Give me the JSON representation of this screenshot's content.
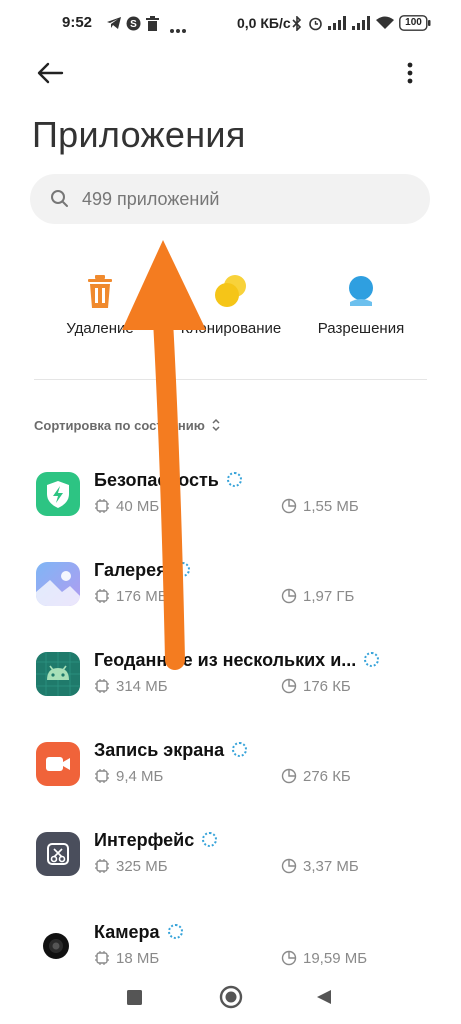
{
  "status_bar": {
    "time": "9:52",
    "network_speed": "0,0 КБ/с",
    "battery": "100"
  },
  "header": {
    "title": "Приложения"
  },
  "search": {
    "placeholder": "499 приложений"
  },
  "shortcuts": [
    {
      "label": "Удаление",
      "icon": "trash-icon",
      "color": "#f08a2e"
    },
    {
      "label": "Клонирование",
      "icon": "clone-icon",
      "color": "#f5c518"
    },
    {
      "label": "Разрешения",
      "icon": "permissions-icon",
      "color": "#2f9fe0"
    }
  ],
  "sort": {
    "label": "Сортировка по состоянию"
  },
  "apps": [
    {
      "name": "Безопасность",
      "memory": "40 МБ",
      "data": "1,55 МБ",
      "icon": "security-icon",
      "color": "#2dc483"
    },
    {
      "name": "Галерея",
      "memory": "176 МБ",
      "data": "1,97 ГБ",
      "icon": "gallery-icon",
      "color": "#8f9bf0"
    },
    {
      "name": "Геоданные из нескольких и...",
      "memory": "314 МБ",
      "data": "176 КБ",
      "icon": "android-icon",
      "color": "#1f7a6b"
    },
    {
      "name": "Запись экрана",
      "memory": "9,4 МБ",
      "data": "276 КБ",
      "icon": "screen-record-icon",
      "color": "#f0633a"
    },
    {
      "name": "Интерфейс",
      "memory": "325 МБ",
      "data": "3,37 МБ",
      "icon": "interface-icon",
      "color": "#4a4e5c"
    },
    {
      "name": "Камера",
      "memory": "18 МБ",
      "data": "19,59 МБ",
      "icon": "camera-icon",
      "color": "#111111"
    }
  ],
  "colors": {
    "arrow": "#f47c20",
    "spinner": "#36a3d9"
  }
}
